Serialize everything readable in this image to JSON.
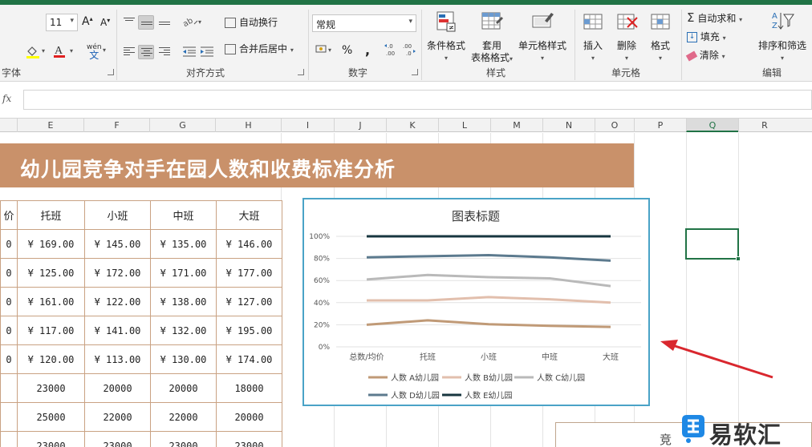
{
  "ribbon": {
    "font_size": "11",
    "grow_font": "A",
    "shrink_font": "A",
    "wen_label": "wén",
    "wen_char": "文",
    "wrap_text": "自动换行",
    "merge_center": "合并后居中",
    "number_format": "常规",
    "percent": "%",
    "comma": ",",
    "dec_inc": "←.0\n.00",
    "dec_dec": ".00\n→.0",
    "cond_format": "条件格式",
    "table_format_1": "套用",
    "table_format_2": "表格格式",
    "cell_style": "单元格样式",
    "insert": "插入",
    "delete": "删除",
    "format": "格式",
    "autosum": "自动求和",
    "fill": "填充",
    "clear": "清除",
    "sort_filter": "排序和筛选",
    "groups": {
      "font": "字体",
      "alignment": "对齐方式",
      "number": "数字",
      "styles": "样式",
      "cells": "单元格",
      "editing": "编辑"
    }
  },
  "formula_bar": {
    "fx": "fx",
    "value": ""
  },
  "columns": [
    "E",
    "F",
    "G",
    "H",
    "I",
    "J",
    "K",
    "L",
    "M",
    "N",
    "O",
    "P",
    "Q",
    "R"
  ],
  "selected_column": "Q",
  "sheet": {
    "title": "幼儿园竞争对手在园人数和收费标准分析",
    "header_partial": "价",
    "headers": [
      "托班",
      "小班",
      "中班",
      "大班"
    ],
    "price_rows": [
      [
        "¥  169.00",
        "¥  145.00",
        "¥  135.00",
        "¥  146.00"
      ],
      [
        "¥  125.00",
        "¥  172.00",
        "¥  171.00",
        "¥  177.00"
      ],
      [
        "¥  161.00",
        "¥  122.00",
        "¥  138.00",
        "¥  127.00"
      ],
      [
        "¥  117.00",
        "¥  141.00",
        "¥  132.00",
        "¥  195.00"
      ],
      [
        "¥  120.00",
        "¥  113.00",
        "¥  130.00",
        "¥  174.00"
      ]
    ],
    "count_rows": [
      [
        "23000",
        "20000",
        "20000",
        "18000"
      ],
      [
        "25000",
        "22000",
        "22000",
        "20000"
      ],
      [
        "23000",
        "23000",
        "23000",
        "23000"
      ]
    ],
    "partial_left": [
      "0",
      "0",
      "0",
      "0",
      "0"
    ],
    "box2_text": "竞"
  },
  "chart_data": {
    "type": "line",
    "title": "图表标题",
    "categories": [
      "总数/均价",
      "托班",
      "小班",
      "中班",
      "大班"
    ],
    "y_ticks": [
      "0%",
      "20%",
      "40%",
      "60%",
      "80%",
      "100%"
    ],
    "ylim": [
      0,
      1
    ],
    "grid": true,
    "legend_position": "bottom",
    "series": [
      {
        "name": "人数 A幼儿园",
        "color": "#c09a77",
        "values": [
          0.2,
          0.24,
          0.205,
          0.19,
          0.18
        ]
      },
      {
        "name": "人数 B幼儿园",
        "color": "#e2bfad",
        "values": [
          0.42,
          0.42,
          0.45,
          0.43,
          0.4
        ]
      },
      {
        "name": "人数 C幼儿园",
        "color": "#b9b9b9",
        "values": [
          0.61,
          0.65,
          0.63,
          0.62,
          0.55
        ]
      },
      {
        "name": "人数 D幼儿园",
        "color": "#5c7a8e",
        "values": [
          0.81,
          0.82,
          0.83,
          0.81,
          0.78
        ]
      },
      {
        "name": "人数 E幼儿园",
        "color": "#17363f",
        "values": [
          1.0,
          1.0,
          1.0,
          1.0,
          1.0
        ]
      }
    ]
  },
  "watermark": {
    "text": "易软汇",
    "color": "#1e88e5"
  },
  "colors": {
    "excel_green": "#217346",
    "title_band": "#c9916a",
    "table_border": "#c9a283",
    "chart_border": "#4aa3c7",
    "arrow": "#d9272e"
  }
}
